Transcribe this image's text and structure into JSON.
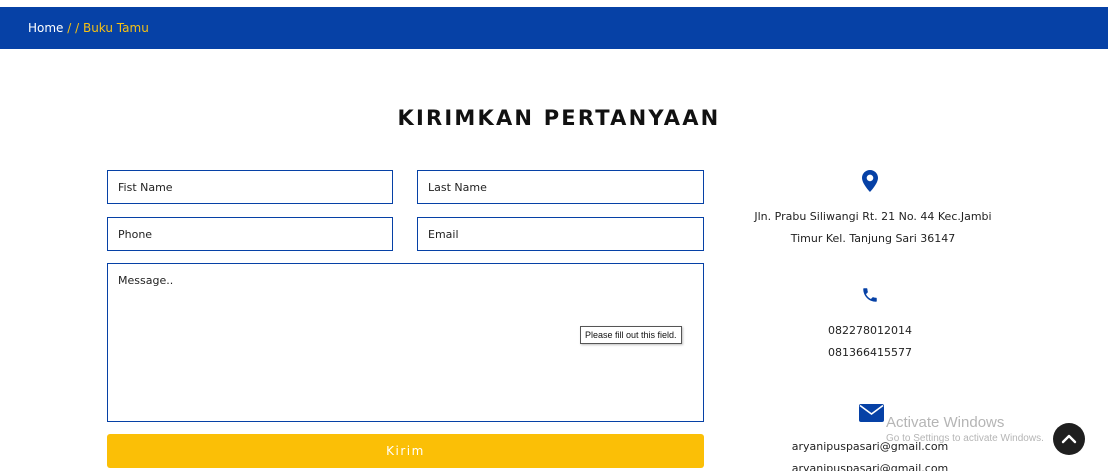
{
  "breadcrumb": {
    "home": "Home",
    "separator": " / / ",
    "current": "Buku Tamu"
  },
  "page_title": "KIRIMKAN PERTANYAAN",
  "form": {
    "first_name_placeholder": "Fist Name",
    "last_name_placeholder": "Last Name",
    "phone_placeholder": "Phone",
    "email_placeholder": "Email",
    "message_placeholder": "Message..",
    "validation_tooltip": "Please fill out this field.",
    "submit_label": "Kirim"
  },
  "contact": {
    "address_line1": "Jln. Prabu Siliwangi Rt. 21 No. 44 Kec.Jambi",
    "address_line2": "Timur Kel. Tanjung Sari 36147",
    "phone1": "082278012014",
    "phone2": "081366415577",
    "email1": "aryanipuspasari@gmail.com",
    "email2": "aryanipuspasari@gmail.com"
  },
  "watermark": {
    "line1": "Activate Windows",
    "line2": "Go to Settings to activate Windows."
  },
  "icons": {
    "address": "map-marker-icon",
    "phone": "phone-icon",
    "email": "envelope-icon",
    "scroll_top": "chevron-up-icon"
  },
  "colors": {
    "primary": "#0641a6",
    "accent": "#fbbf06",
    "breadcrumb_active": "#f5c014"
  }
}
